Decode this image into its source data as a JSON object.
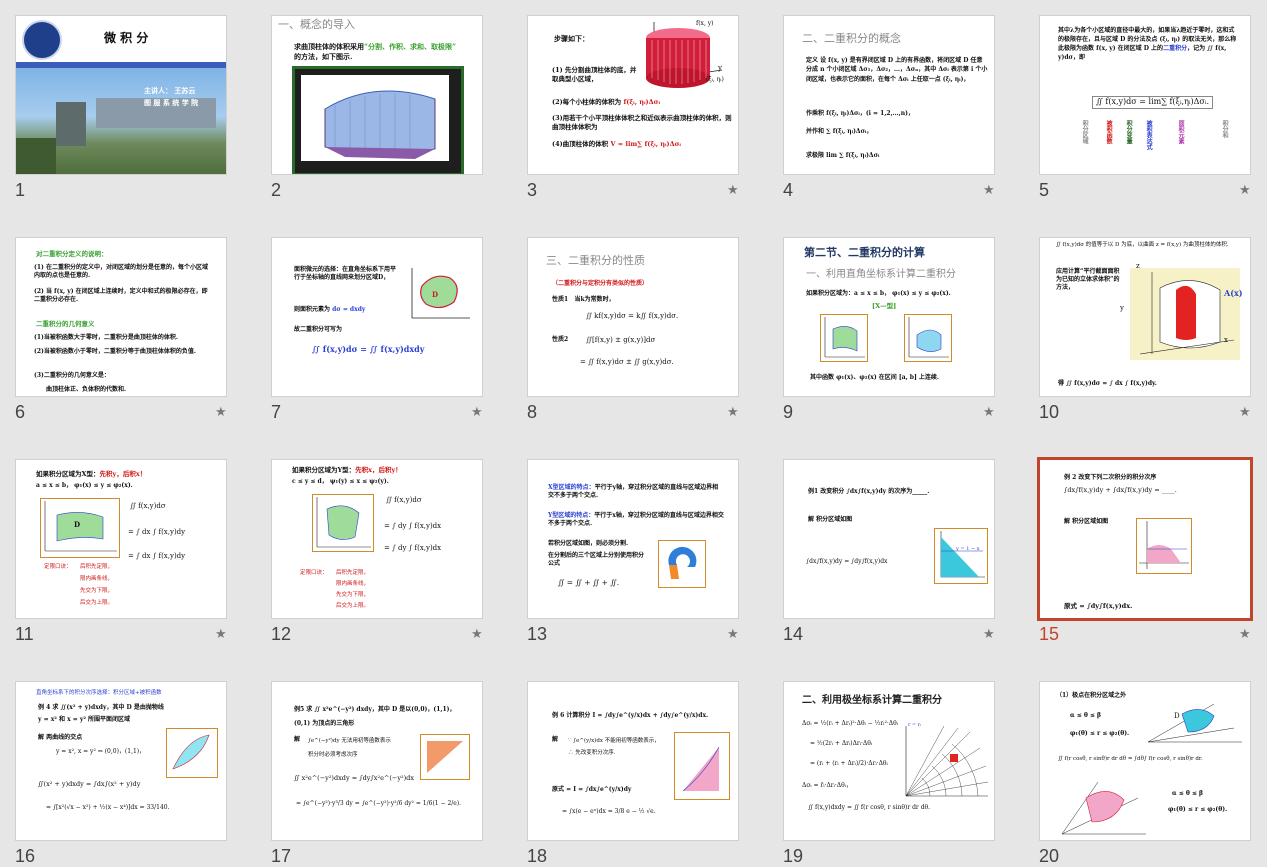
{
  "slides": [
    {
      "num": "1",
      "title": "微 积 分",
      "lead": "主讲人： 王苏云",
      "dept": "图 服 系 统 学 院"
    },
    {
      "num": "2",
      "heading": "一、概念的导入",
      "line1": "求曲顶柱体的体积采用",
      "kw": "“分割、作积、求和、取极限”",
      "line2": "的方法，如下图示."
    },
    {
      "num": "3",
      "steps": "步骤如下：",
      "s1": "(1) 先分割曲顶柱体的底，并取典型小区域，",
      "s2": "(2)每个小柱体的体积为",
      "s3": "(3)用若干个小平顶柱体体积之和近似表示曲顶柱体的体积，则曲顶柱体体积为",
      "s4": "(4)曲顶柱体的体积",
      "fxy": "f(x, y)",
      "yl": "y",
      "pt": "(ξᵢ, ηᵢ)"
    },
    {
      "num": "4",
      "heading": "二、二重积分的概念",
      "def": "定义  设 f(x, y) 是有界闭区域 D 上的有界函数，将闭区域 D 任意分成 n 个小闭区域 Δσ₁，Δσ₂，…，Δσₙ，其中 Δσᵢ 表示第 i 个小闭区域，也表示它的面积，在每个 Δσᵢ 上任取一点 (ξᵢ, ηᵢ)，",
      "prod": "作乘积  f(ξᵢ, ηᵢ)Δσᵢ，(i = 1,2,…,n)，",
      "sum": "并作和    ∑ f(ξᵢ, ηᵢ)Δσᵢ，",
      "lim": "求极限    lim ∑ f(ξᵢ, ηᵢ)Δσᵢ"
    },
    {
      "num": "5",
      "text1": "其中λ为各个小区域的直径中最大的，如果当λ趋近于零时，这和式的极限存在，且与区域 D 的分法及点 (ξᵢ, ηᵢ) 的取法无关，那么称此极限为函数 f(x, y) 在闭区域 D 上的",
      "kw": "二重积分",
      "text2": "，记为 ∬ f(x, y)dσ，即",
      "labels": [
        "积分区域",
        "被积函数",
        "积分变量",
        "被积表达式",
        "面积元素",
        "积分和"
      ]
    },
    {
      "num": "6",
      "h": "对二重积分定义的说明：",
      "p1": "(1) 在二重积分的定义中，对闭区域的划分是任意的，每个小区域内取的点也是任意的.",
      "p2": "(2) 当 f(x, y) 在闭区域上连续时，定义中和式的极限必存在，即二重积分必存在.",
      "h2": "二重积分的几何意义",
      "q1": "(1)当被积函数大于零时，二重积分是曲顶柱体的体积.",
      "q2": "(2)当被积函数小于零时，二重积分等于曲顶柱体体积的负值.",
      "q3": "(3)二重积分的几何意义是：",
      "q4": "曲顶柱体正、负体积的代数和."
    },
    {
      "num": "7",
      "p1": "面积微元的选择：在直角坐标系下用平行于坐标轴的直线网来划分区域D，",
      "p2": "则面积元素为",
      "ds": "dσ = dxdy",
      "p3": "故二重积分可写为",
      "eq": "∬ f(x,y)dσ = ∬ f(x,y)dxdy",
      "D": "D"
    },
    {
      "num": "8",
      "heading": "三、二重积分的性质",
      "sub": "（二重积分与定积分有类似的性质）",
      "pr1": "性质1",
      "pr1t": "当k为常数时，",
      "pr1e": "∬ kf(x,y)dσ = k∬ f(x,y)dσ.",
      "pr2": "性质2",
      "pr2e": "∬[f(x,y) ± g(x,y)]dσ",
      "pr2f": "= ∬ f(x,y)dσ ± ∬ g(x,y)dσ."
    },
    {
      "num": "9",
      "heading": "第二节、二重积分的计算",
      "sub": "一、利用直角坐标系计算二重积分",
      "p1": "如果积分区域为：a ≤ x ≤ b，  φ₁(x) ≤ y ≤ φ₂(x).",
      "tag": "[X—型]",
      "p2": "其中函数 φ₁(x)、φ₂(x) 在区间 [a, b] 上连续."
    },
    {
      "num": "10",
      "p1": "∬ f(x,y)dσ 的值等于以 D 为底，以曲面 z = f(x,y) 为曲顶柱体的体积.",
      "p2": "应用计算“平行截面面积为已知的立体求体积”的方法，",
      "p3": "得 ∬ f(x,y)dσ = ∫ dx ∫ f(x,y)dy.",
      "A": "A(x)",
      "zl": "z",
      "xl": "x",
      "yl": "y"
    },
    {
      "num": "11",
      "h": "如果积分区域为X型：",
      "hk": "先积y，后积x！",
      "range": "a ≤ x ≤ b，  φ₁(x) ≤ y ≤ φ₂(x).",
      "tips": [
        "定限口诀：",
        "后积先定限，",
        "限内画条线，",
        "先交为下限，",
        "后交为上限。"
      ],
      "e1": "∬ f(x,y)dσ",
      "e2": "= ∫ dx ∫ f(x,y)dy",
      "e3": "= ∫ dx ∫ f(x,y)dy",
      "D": "D"
    },
    {
      "num": "12",
      "h": "如果积分区域为Y型：",
      "hk": "先积x，后积y！",
      "range": "c ≤ y ≤ d，  ψ₁(y) ≤ x ≤ ψ₂(y).",
      "tips": [
        "定限口诀：",
        "后积先定限，",
        "限内画条线，",
        "先交为下限，",
        "后交为上限。"
      ],
      "e1": "∬ f(x,y)dσ",
      "e2": "= ∫ dy ∫ f(x,y)dx",
      "e3": "= ∫ dy ∫ f(x,y)dx",
      "D": "D"
    },
    {
      "num": "13",
      "x1": "X型区域的特点：",
      "x1t": "平行于y轴，穿过积分区域的直线与区域边界相交不多于两个交点.",
      "y1": "Y型区域的特点：",
      "y1t": "平行于x轴，穿过积分区域的直线与区域边界相交不多于两个交点.",
      "p3": "若积分区域如图，则必须分割.",
      "p4": "在分割后的三个区域上分别使用积分公式",
      "eq": "∬ = ∬ + ∬ + ∬."
    },
    {
      "num": "14",
      "ex": "例1   改变积分 ∫dx∫f(x,y)dy 的次序为_____.",
      "sol": "解  积分区域如图",
      "ans": "∫dx∫f(x,y)dy = ∫dy∫f(x,y)dx",
      "ln": "y = 1 − x"
    },
    {
      "num": "15",
      "ex": "例 2   改变下列二次积分的积分次序",
      "eq": "∫dx∫f(x,y)dy + ∫dx∫f(x,y)dy = ____.",
      "sol": "解  积分区域如图",
      "ans": "原式 = ∫dy∫f(x,y)dx."
    },
    {
      "num": "16",
      "top": "直角坐标系下的积分次序选择：积分区域+被积函数",
      "ex": "例 4   求 ∬(x² + y)dxdy，其中 D 是由抛物线",
      "ex2": "y = x² 和 x = y² 所围平面闭区域",
      "sol": "解   两曲线的交点",
      "sys": "y = x², x = y² ⇒ (0,0)，(1,1)，",
      "e1": "∬(x² + y)dxdy = ∫dx∫(x² + y)dy",
      "e2": "= ∫[x²(√x − x²) + ½(x − x⁴)]dx = 33/140."
    },
    {
      "num": "17",
      "ex": "例5  求 ∬ x²e^(−y²) dxdy，其中 D 是以(0,0)，(1,1)，",
      "ex2": "(0,1) 为顶点的三角形",
      "sol": "解",
      "p1": "∫e^(−y²)dy 无法用初等函数表示",
      "p2": "积分时必须考虑次序",
      "e1": "∬ x²e^(−y²)dxdy = ∫dy∫x²e^(−y²)dx",
      "e2": "= ∫e^(−y²)·y³/3 dy = ∫e^(−y²)·y²/6 dy² = 1/6(1 − 2/e)."
    },
    {
      "num": "18",
      "ex": "例 6   计算积分  I = ∫dy∫e^(y/x)dx + ∫dy∫e^(y/x)dx.",
      "sol": "解",
      "p1": "∵ ∫e^(y/x)dx 不能用初等函数表示，",
      "p2": "∴ 先改变积分次序.",
      "e1": "原式 = I = ∫dx∫e^(y/x)dy",
      "e2": "= ∫x(e − eˣ)dx = 3/8 e − ½ √e."
    },
    {
      "num": "19",
      "heading": "二、利用极坐标系计算二重积分",
      "e1": "Δσᵢ = ½(rᵢ + Δrᵢ)²·Δθᵢ − ½rᵢ²·Δθᵢ",
      "e2": "= ½(2rᵢ + Δrᵢ)Δrᵢ·Δθᵢ",
      "e3": "= (rᵢ + (rᵢ + Δrᵢ)/2)·Δrᵢ·Δθᵢ",
      "e4": "Δσᵢ = r̄ᵢ·Δrᵢ·Δθᵢ，",
      "e5": "∬ f(x,y)dxdy = ∬ f(r cosθ, r sinθ)r dr dθ.",
      "lab": "r = rᵢ"
    },
    {
      "num": "20",
      "h": "（1）极点在积分区域之外",
      "r1": "α ≤ θ ≤ β",
      "r2": "φ₁(θ) ≤ r ≤ φ₂(θ).",
      "e1": "∬ f(r cosθ, r sinθ)r dr dθ = ∫dθ∫ f(r cosθ, r sinθ)r dr.",
      "r3": "α ≤ θ ≤ β",
      "r4": "φ₁(θ) ≤ r ≤ φ₂(θ).",
      "D": "D"
    }
  ],
  "selected_slide": "15",
  "star_glyph": "★",
  "colors": {
    "selected": "#c0462b",
    "red": "#d01818",
    "blue": "#2a3fd0",
    "green": "#3aa030"
  }
}
